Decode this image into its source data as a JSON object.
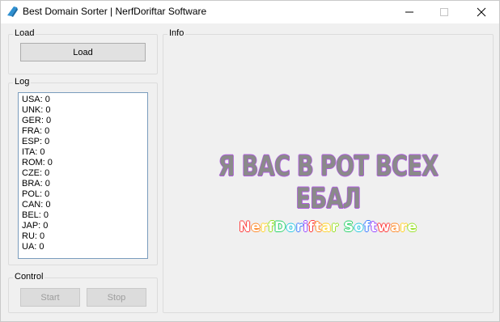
{
  "window": {
    "title": "Best Domain Sorter | NerfDoriftar Software",
    "controls": [
      "minimize-icon",
      "maximize-icon",
      "close-icon"
    ]
  },
  "load_group": {
    "label": "Load",
    "load_button": "Load"
  },
  "log_group": {
    "label": "Log",
    "lines": [
      "USA: 0",
      "UNK: 0",
      "GER: 0",
      "FRA: 0",
      "ESP: 0",
      "ITA: 0",
      "ROM: 0",
      "CZE: 0",
      "BRA: 0",
      "POL: 0",
      "CAN: 0",
      "BEL: 0",
      "JAP: 0",
      "RU: 0",
      "UA: 0"
    ]
  },
  "control_group": {
    "label": "Control",
    "start_button": "Start",
    "stop_button": "Stop"
  },
  "info_group": {
    "label": "Info",
    "headline": "Я ВАС В РОТ ВСЕХ ЕБАЛ",
    "brand": "NerfDoriftar Software",
    "brand_colors": [
      "#ff3b3b",
      "#ff8a2a",
      "#ffd22a",
      "#9ae22a",
      "#2ad26a",
      "#2ac8e2",
      "#3a7bff",
      "#9a4bff"
    ]
  },
  "colors": {
    "headline_fill": "#8a8a8a",
    "headline_outline": "#b05ce0",
    "logbox_border": "#7a9cbd"
  }
}
